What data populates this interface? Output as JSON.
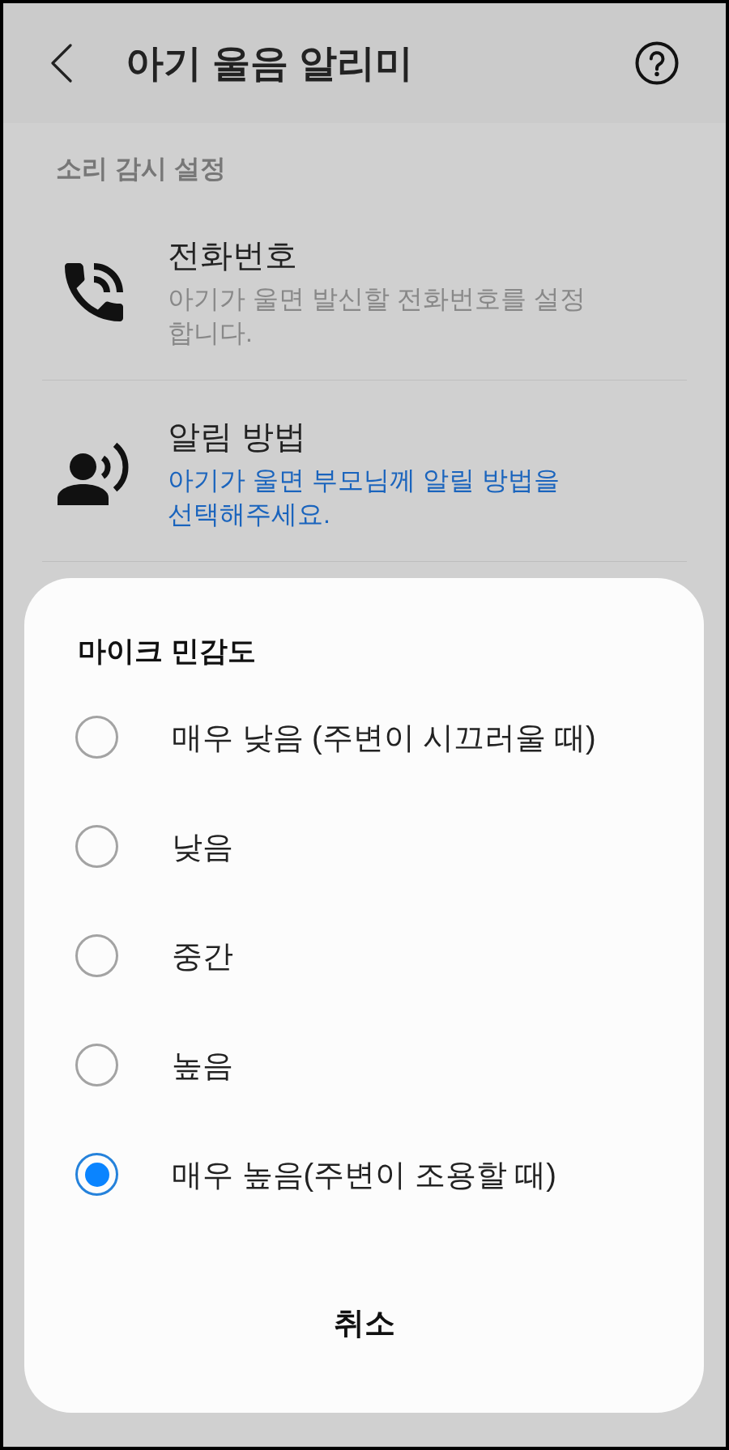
{
  "app_bar": {
    "title": "아기 울음 알리미"
  },
  "section": {
    "header": "소리 감시 설정",
    "items": [
      {
        "kind": "phone",
        "title": "전화번호",
        "summary": "아기가 울면 발신할 전화번호를 설정합니다.",
        "highlighted": false
      },
      {
        "kind": "alert",
        "title": "알림 방법",
        "summary": "아기가 울면 부모님께 알릴 방법을 선택해주세요.",
        "highlighted": true
      }
    ]
  },
  "dialog": {
    "title": "마이크 민감도",
    "options": [
      {
        "label": "매우 낮음 (주변이 시끄러울 때)",
        "selected": false
      },
      {
        "label": "낮음",
        "selected": false
      },
      {
        "label": "중간",
        "selected": false
      },
      {
        "label": "높음",
        "selected": false
      },
      {
        "label": "매우 높음(주변이 조용할 때)",
        "selected": true
      }
    ],
    "cancel_button": "취소"
  }
}
